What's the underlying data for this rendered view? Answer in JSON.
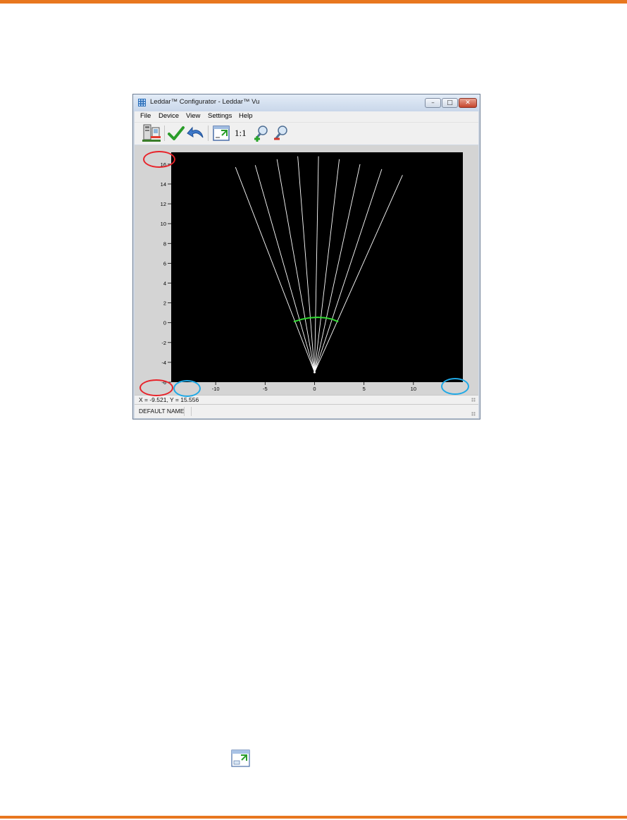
{
  "window": {
    "title": "Leddar™ Configurator - Leddar™ Vu",
    "caption_buttons": {
      "minimize": "–",
      "maximize": "□",
      "close": "✕"
    }
  },
  "menu": [
    "File",
    "Device",
    "View",
    "Settings",
    "Help"
  ],
  "toolbar": {
    "icons": [
      "device-connection-icon",
      "checkmark-icon",
      "undo-arrow-icon",
      "fit-view-icon",
      "zoom-in-icon",
      "zoom-out-icon"
    ],
    "one_to_one_label": "1:1"
  },
  "chart_data": {
    "type": "line",
    "x_ticks": [
      "-10",
      "-5",
      "0",
      "5",
      "10"
    ],
    "y_ticks": [
      "16",
      "14",
      "12",
      "10",
      "8",
      "6",
      "4",
      "2",
      "0",
      "-2",
      "-4",
      "-6"
    ],
    "xlim": [
      -14.5,
      15
    ],
    "ylim": [
      -6,
      17.2
    ],
    "origin": [
      0,
      -5
    ],
    "segment_endpoints_x": [
      -8.0,
      -6.0,
      -3.8,
      -1.7,
      0.4,
      2.5,
      4.6,
      6.8,
      8.9
    ],
    "segment_endpoints_y": [
      15.7,
      15.9,
      16.5,
      16.8,
      16.8,
      16.5,
      16.0,
      15.5,
      14.9
    ],
    "detection_arc": {
      "x": [
        -2.1,
        -1.3,
        -0.5,
        0.3,
        1.1,
        1.8,
        2.4
      ],
      "y": [
        0.1,
        0.35,
        0.5,
        0.55,
        0.5,
        0.35,
        0.1
      ]
    },
    "colors": {
      "background": "#000000",
      "segments": "#ffffff",
      "detection": "#33dd33"
    }
  },
  "coordinates": "X = -9.521, Y = 15.556",
  "status": {
    "device_name": "DEFAULT NAME"
  },
  "colors": {
    "accent_rule": "#e8771f",
    "highlight_red": "#e8232a",
    "highlight_blue": "#1fa9e6"
  }
}
